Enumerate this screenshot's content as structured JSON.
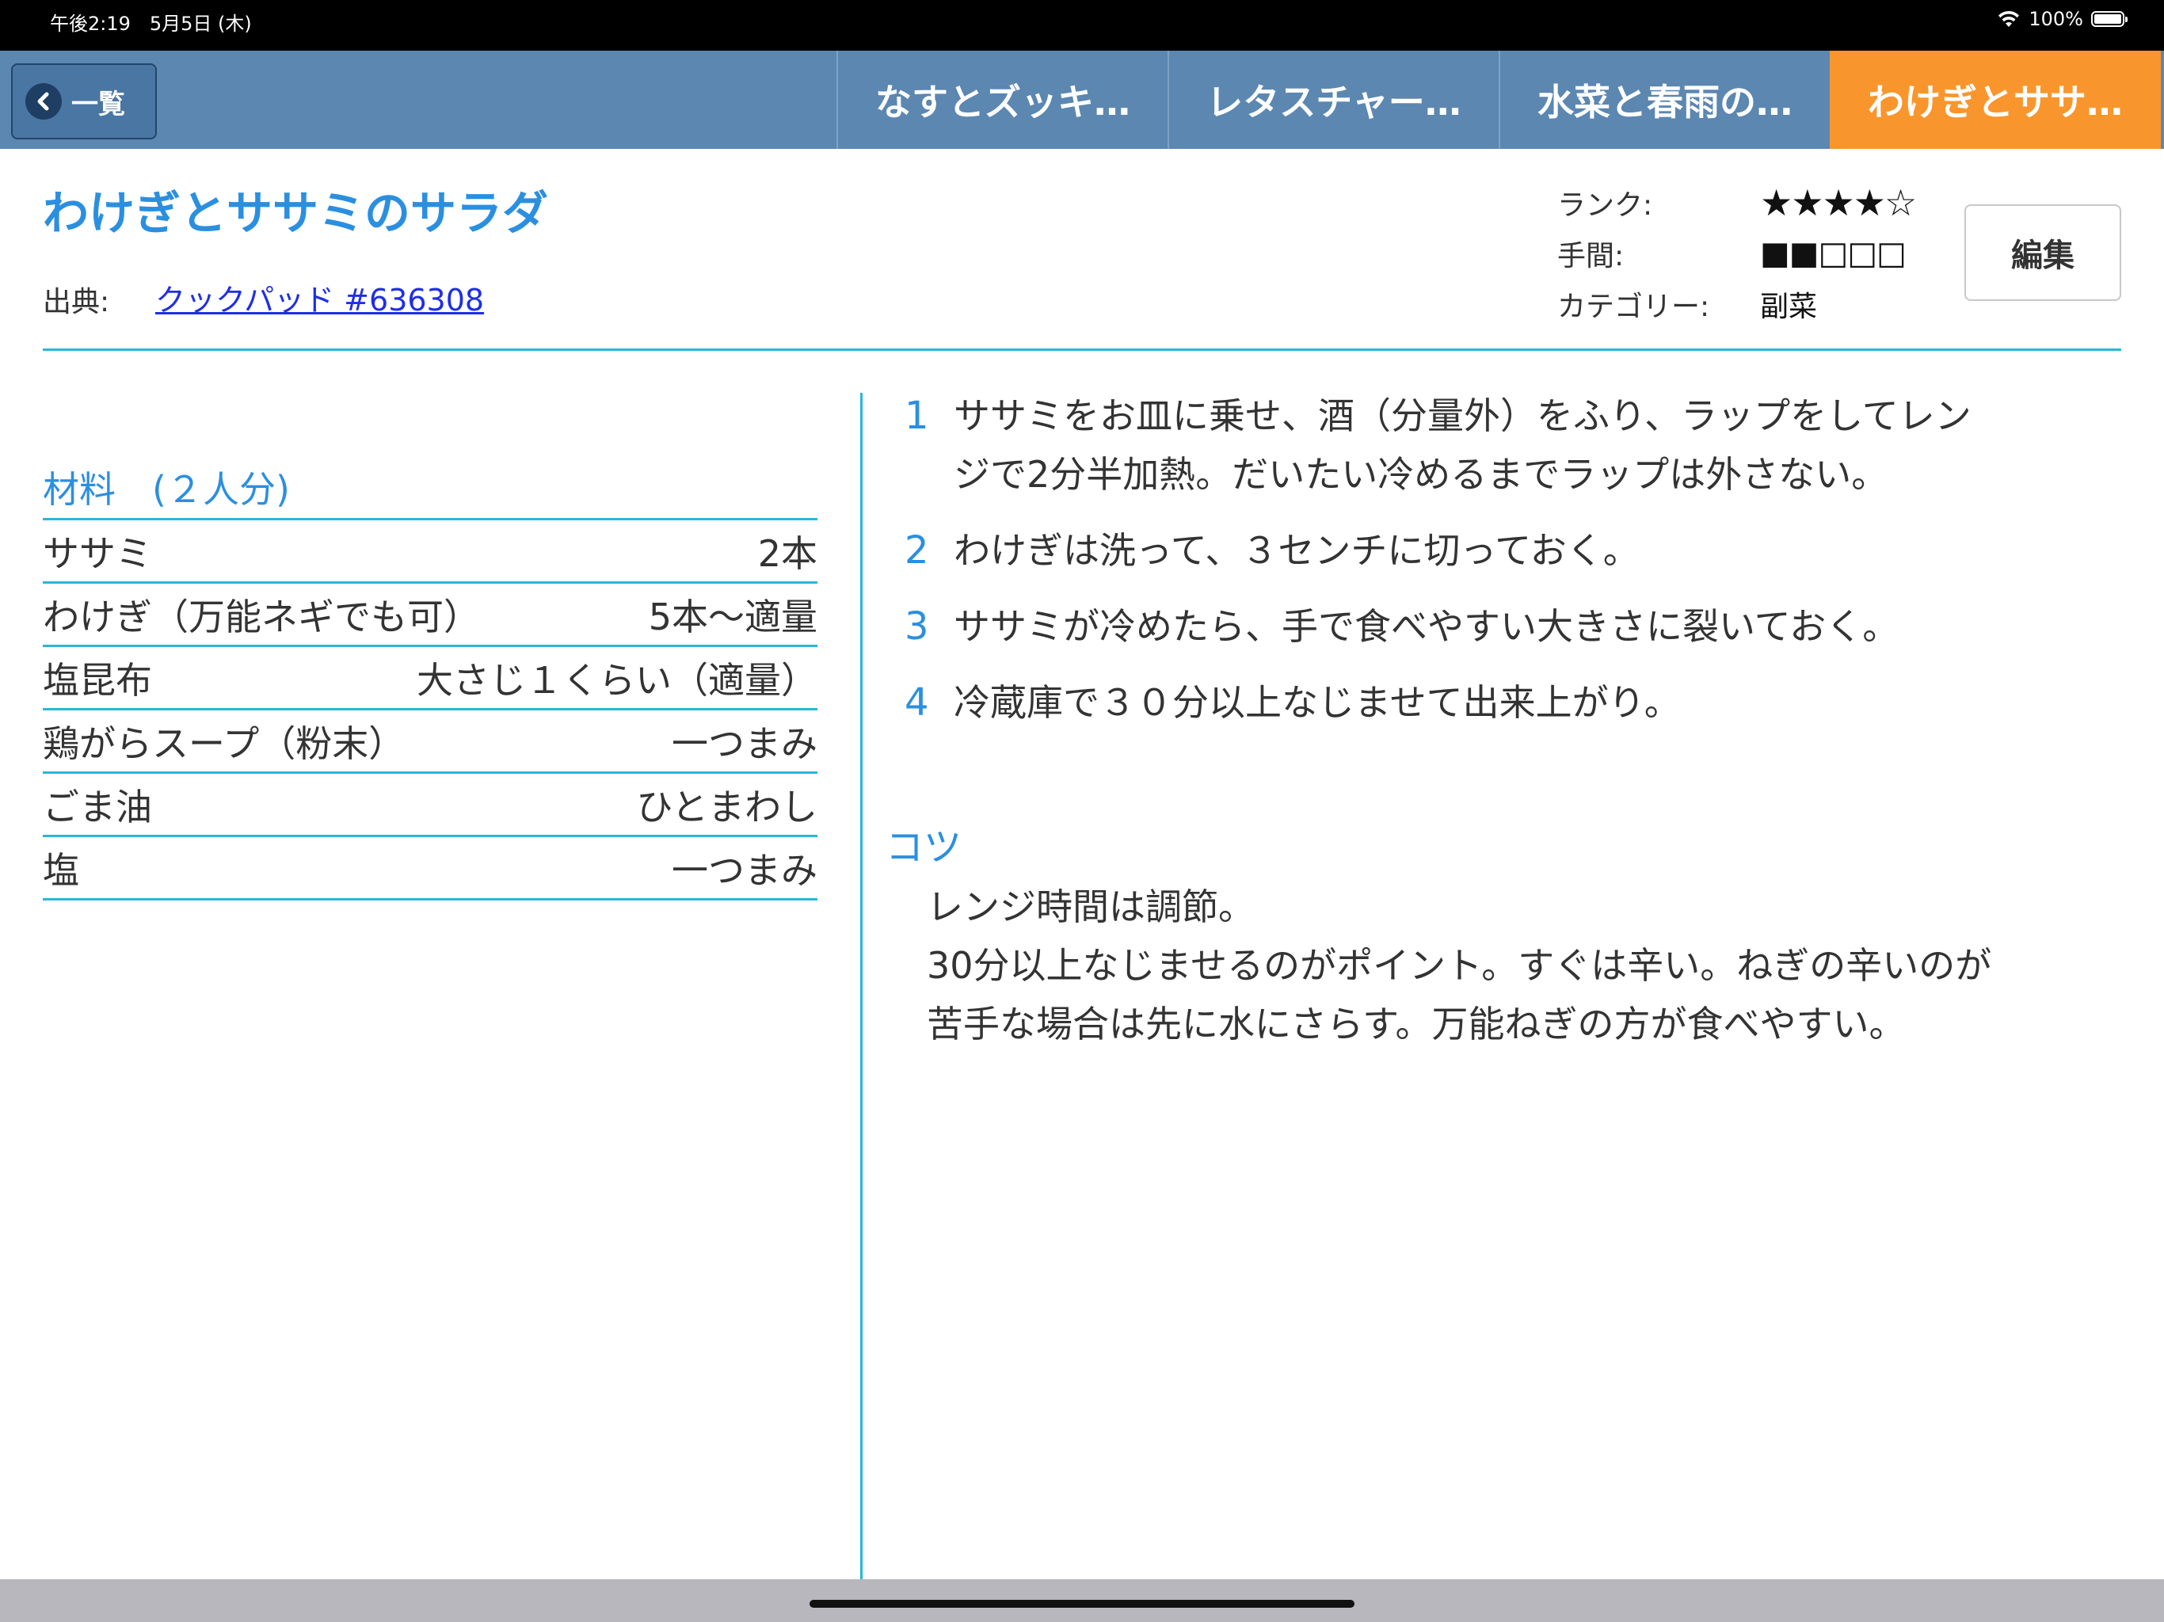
{
  "status_bar": {
    "time": "午後2:19　5月5日 (木)",
    "battery": "100%"
  },
  "nav": {
    "back_label": "一覧",
    "tabs": [
      {
        "label": "なすとズッキ…",
        "active": false
      },
      {
        "label": "レタスチャー…",
        "active": false
      },
      {
        "label": "水菜と春雨の…",
        "active": false
      },
      {
        "label": "わけぎとササ…",
        "active": true
      }
    ]
  },
  "recipe": {
    "title": "わけぎとササミのサラダ",
    "source_label": "出典:",
    "source_link": "クックパッド #636308",
    "meta": {
      "rank_label": "ランク:",
      "rank_value": "★★★★☆",
      "effort_label": "手間:",
      "effort_value": "■■□□□",
      "category_label": "カテゴリー:",
      "category_value": "副菜"
    },
    "edit_label": "編集"
  },
  "ingredients": {
    "heading": "材料　(２人分)",
    "items": [
      {
        "name": "ササミ",
        "qty": "2本"
      },
      {
        "name": "わけぎ（万能ネギでも可）",
        "qty": "5本〜適量"
      },
      {
        "name": "塩昆布",
        "qty": "大さじ１くらい（適量）"
      },
      {
        "name": "鶏がらスープ（粉末）",
        "qty": "一つまみ"
      },
      {
        "name": "ごま油",
        "qty": "ひとまわし"
      },
      {
        "name": "塩",
        "qty": "一つまみ"
      }
    ]
  },
  "steps": [
    {
      "num": "1",
      "lines": [
        "ササミをお皿に乗せ、酒（分量外）をふり、ラップをしてレン",
        "ジで2分半加熱。だいたい冷めるまでラップは外さない。"
      ]
    },
    {
      "num": "2",
      "lines": [
        "わけぎは洗って、３センチに切っておく。"
      ]
    },
    {
      "num": "3",
      "lines": [
        "ササミが冷めたら、手で食べやすい大きさに裂いておく。"
      ]
    },
    {
      "num": "4",
      "lines": [
        "冷蔵庫で３０分以上なじませて出来上がり。"
      ]
    }
  ],
  "tips": {
    "heading": "コツ",
    "lines": [
      "レンジ時間は調節。",
      "30分以上なじませるのがポイント。すぐは辛い。ねぎの辛いのが",
      "苦手な場合は先に水にさらす。万能ねぎの方が食べやすい。"
    ]
  },
  "colors": {
    "nav_bar": "#5b87b1",
    "active_tab": "#f8962d",
    "accent_blue": "#2b8fe0",
    "divider": "#27b8d8",
    "link": "#1f2ee6"
  },
  "icons": {
    "back": "chevron-left-icon",
    "wifi": "wifi-icon",
    "battery": "battery-icon"
  }
}
